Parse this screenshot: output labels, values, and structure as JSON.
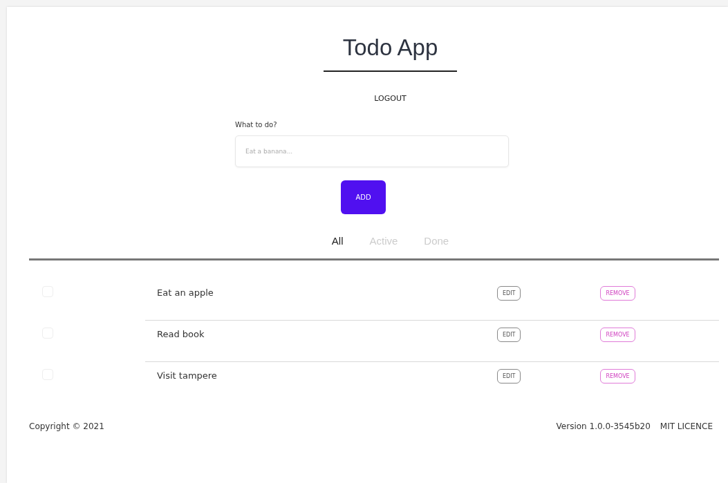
{
  "header": {
    "title": "Todo App",
    "logout": "LOGOUT"
  },
  "form": {
    "label": "What to do?",
    "placeholder": "Eat a banana...",
    "button": "ADD"
  },
  "filters": [
    {
      "label": "All",
      "selected": true
    },
    {
      "label": "Active",
      "selected": false
    },
    {
      "label": "Done",
      "selected": false
    }
  ],
  "todos": [
    {
      "text": "Eat an apple",
      "checked": false,
      "edit": "EDIT",
      "remove": "REMOVE"
    },
    {
      "text": "Read book",
      "checked": false,
      "edit": "EDIT",
      "remove": "REMOVE"
    },
    {
      "text": "Visit tampere",
      "checked": false,
      "edit": "EDIT",
      "remove": "REMOVE"
    }
  ],
  "footer": {
    "copyright": "Copyright © 2021",
    "version": "Version 1.0.0-3545b20",
    "licence": "MIT LICENCE"
  }
}
